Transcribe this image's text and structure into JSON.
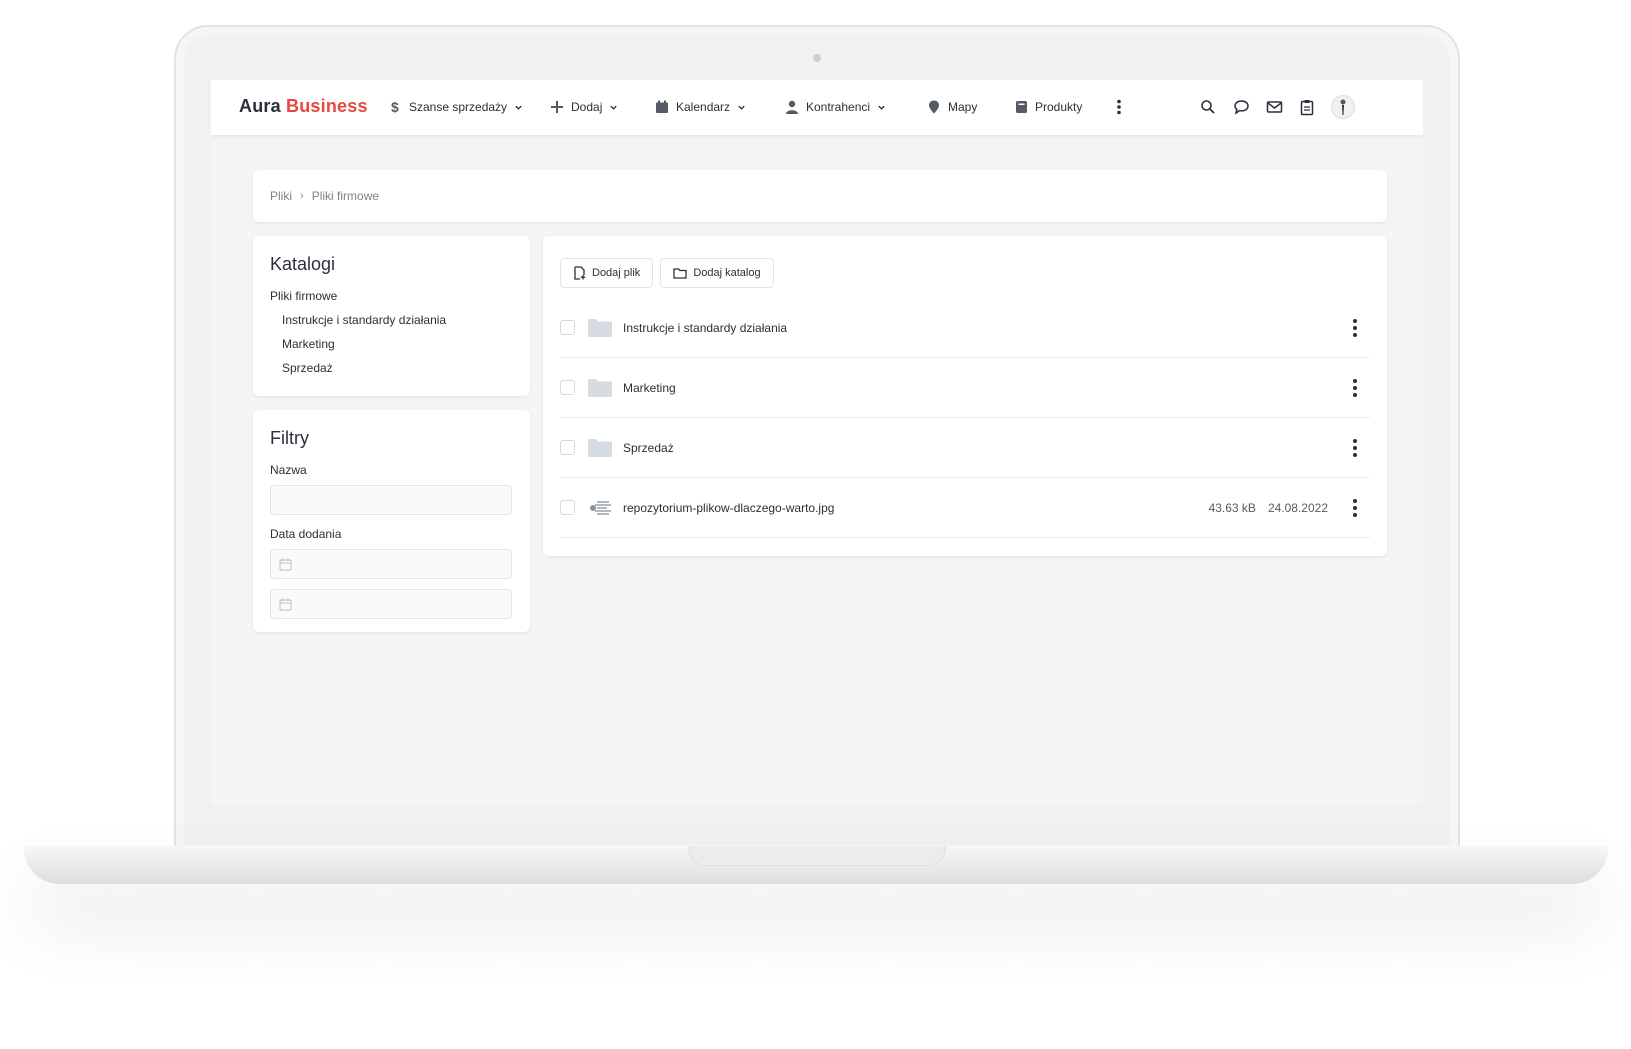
{
  "brand": {
    "part1": "Aura",
    "part2": "Business",
    "accent": "#e8473f"
  },
  "nav": [
    {
      "label": "Szanse sprzedaży",
      "icon": "dollar-icon",
      "dropdown": true
    },
    {
      "label": "Dodaj",
      "icon": "plus-icon",
      "dropdown": true
    },
    {
      "label": "Kalendarz",
      "icon": "calendar-icon",
      "dropdown": true
    },
    {
      "label": "Kontrahenci",
      "icon": "person-icon",
      "dropdown": true
    },
    {
      "label": "Mapy",
      "icon": "map-pin-icon",
      "dropdown": false
    },
    {
      "label": "Produkty",
      "icon": "book-icon",
      "dropdown": false
    }
  ],
  "header_icons": [
    "more-vertical-icon",
    "search-icon",
    "chat-icon",
    "mail-icon",
    "clipboard-icon",
    "avatar"
  ],
  "breadcrumb": {
    "root": "Pliki",
    "current": "Pliki firmowe"
  },
  "katalogi": {
    "title": "Katalogi",
    "root": "Pliki firmowe",
    "children": [
      "Instrukcje i standardy działania",
      "Marketing",
      "Sprzedaż"
    ]
  },
  "filtry": {
    "title": "Filtry",
    "name_label": "Nazwa",
    "name_value": "",
    "date_label": "Data dodania",
    "date_from": "",
    "date_to": ""
  },
  "toolbar": {
    "add_file": "Dodaj plik",
    "add_folder": "Dodaj katalog"
  },
  "files": [
    {
      "type": "folder",
      "name": "Instrukcje i standardy działania",
      "size": "",
      "date": ""
    },
    {
      "type": "folder",
      "name": "Marketing",
      "size": "",
      "date": ""
    },
    {
      "type": "folder",
      "name": "Sprzedaż",
      "size": "",
      "date": ""
    },
    {
      "type": "image",
      "name": "repozytorium-plikow-dlaczego-warto.jpg",
      "size": "43.63 kB",
      "date": "24.08.2022"
    }
  ]
}
